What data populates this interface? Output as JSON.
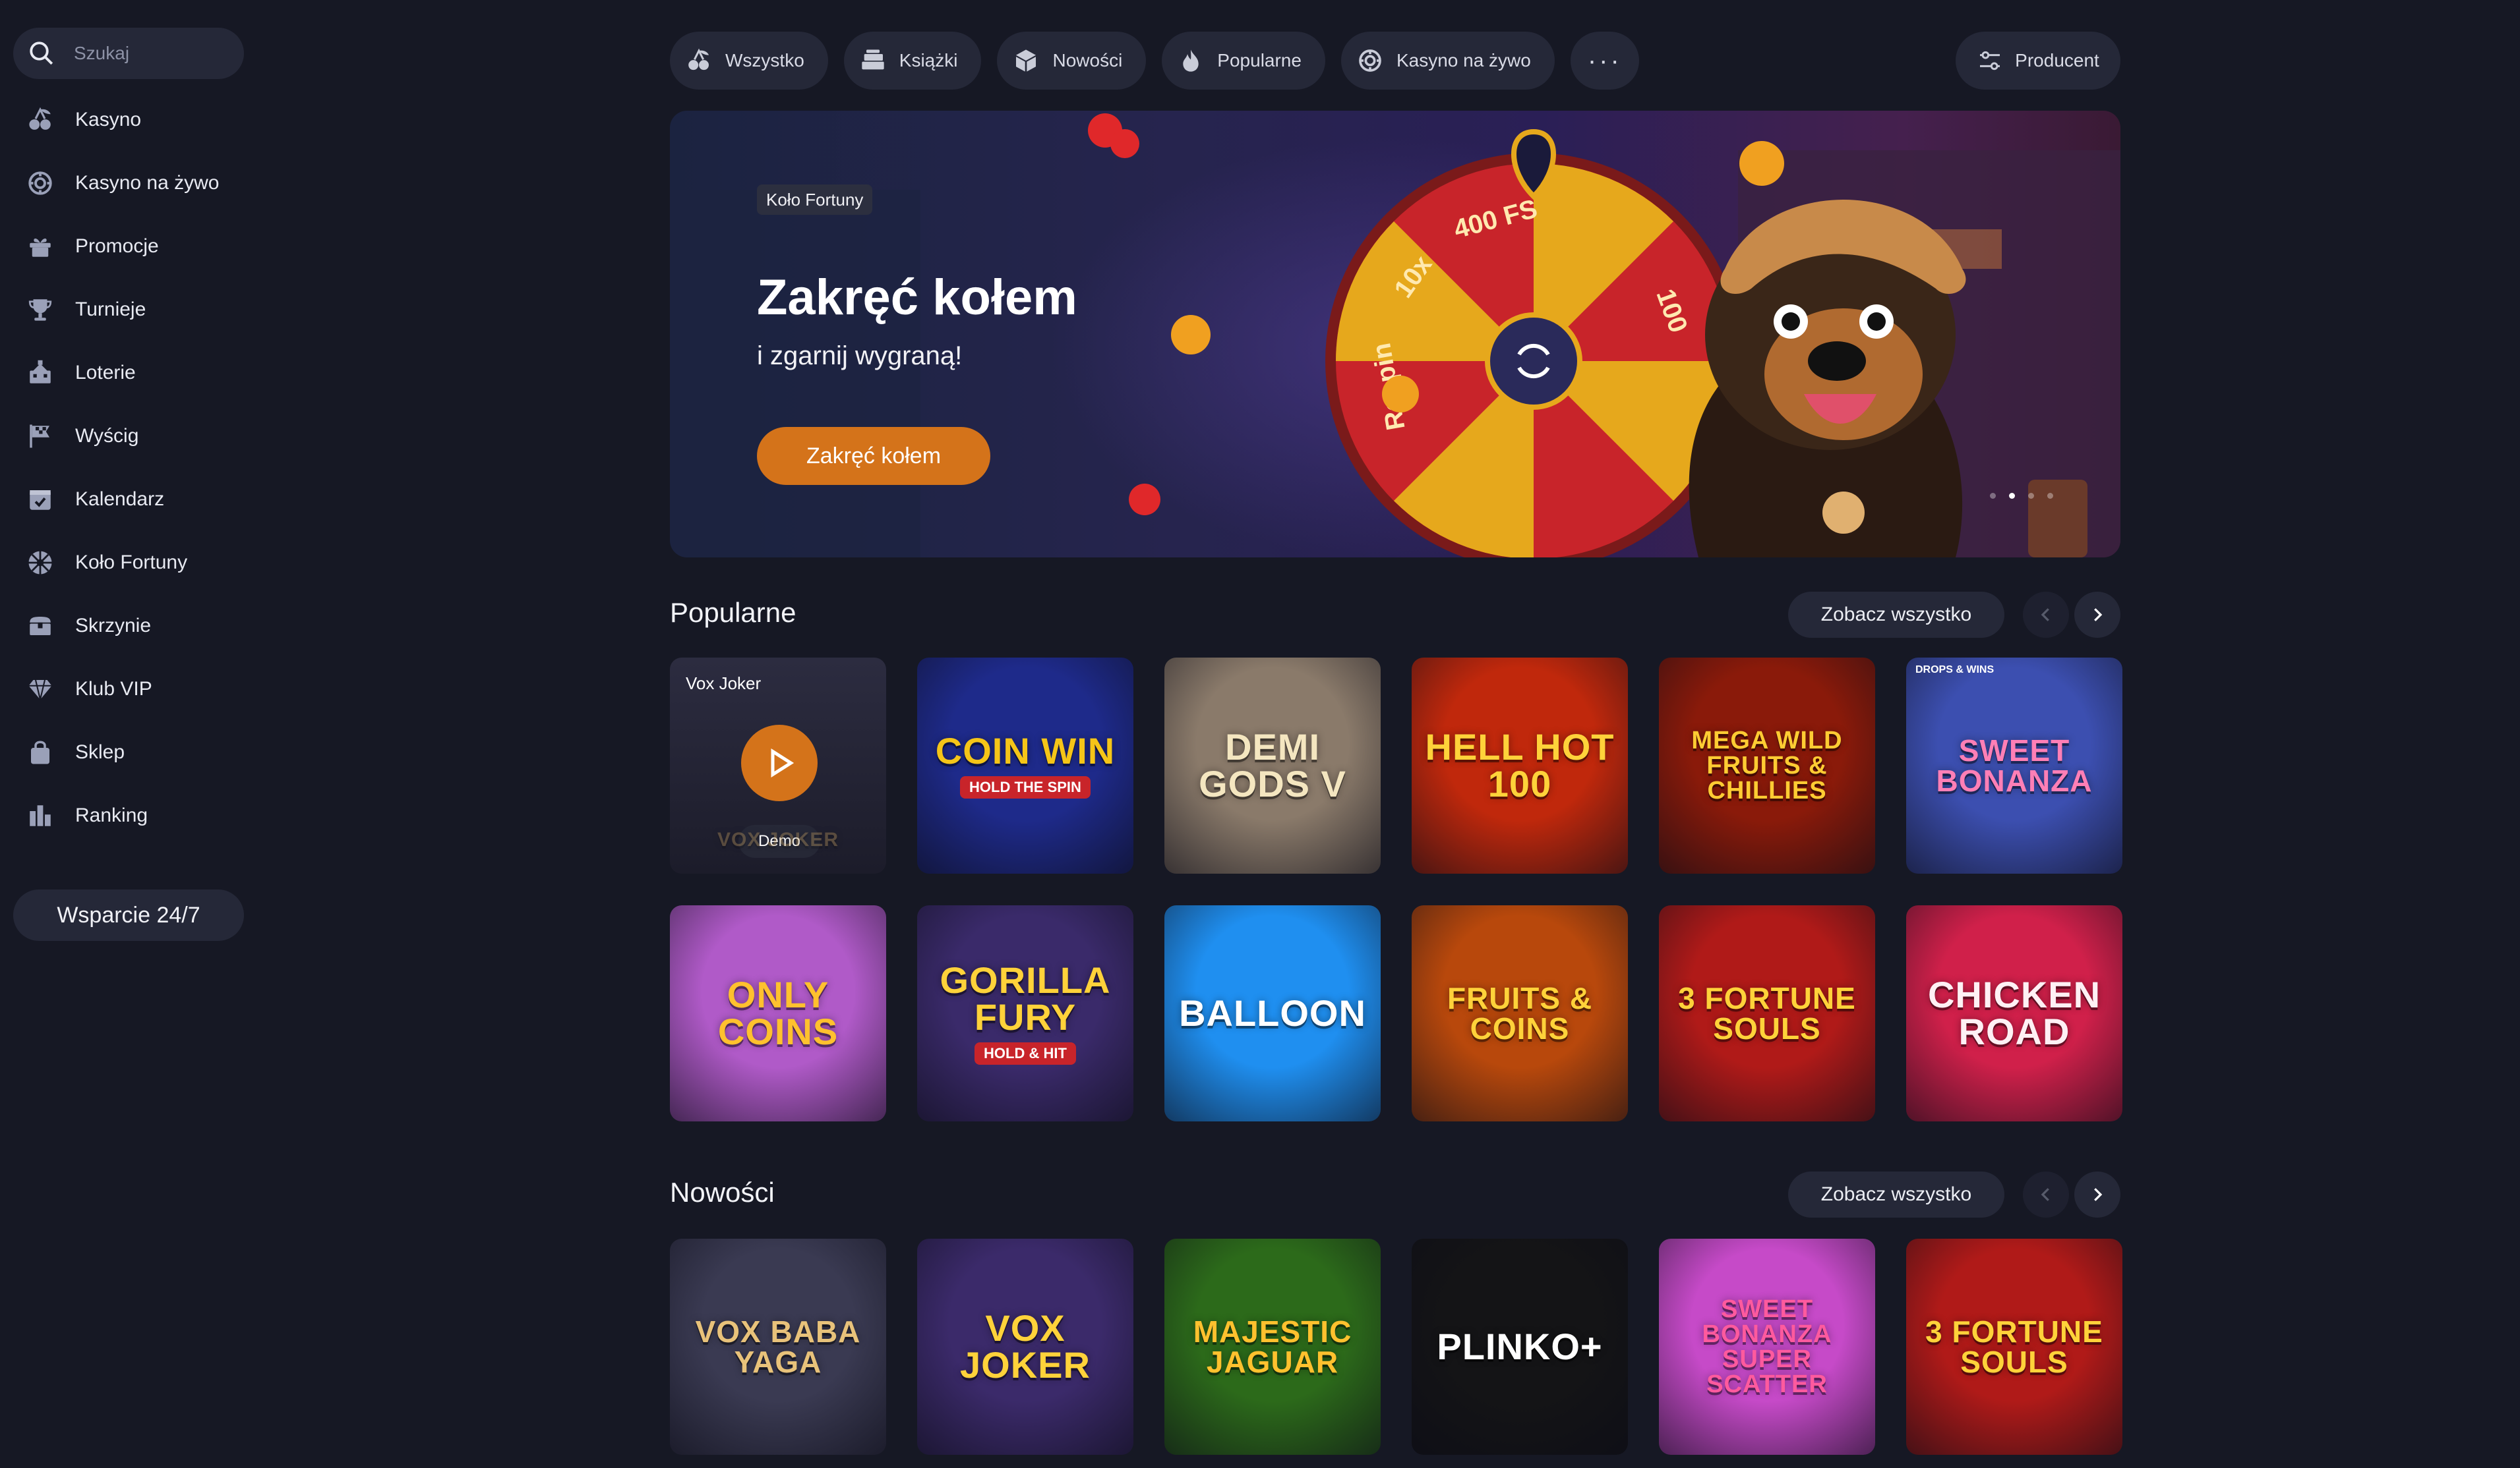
{
  "search": {
    "placeholder": "Szukaj"
  },
  "sidebar": {
    "items": [
      {
        "label": "Kasyno",
        "icon": "cherries-icon"
      },
      {
        "label": "Kasyno na żywo",
        "icon": "chip-icon"
      },
      {
        "label": "Promocje",
        "icon": "gift-icon"
      },
      {
        "label": "Turnieje",
        "icon": "trophy-icon"
      },
      {
        "label": "Loterie",
        "icon": "lottery-icon"
      },
      {
        "label": "Wyścig",
        "icon": "race-flag-icon"
      },
      {
        "label": "Kalendarz",
        "icon": "calendar-icon"
      },
      {
        "label": "Koło Fortuny",
        "icon": "wheel-icon"
      },
      {
        "label": "Skrzynie",
        "icon": "chest-icon"
      },
      {
        "label": "Klub VIP",
        "icon": "diamond-icon"
      },
      {
        "label": "Sklep",
        "icon": "shopping-bag-icon"
      },
      {
        "label": "Ranking",
        "icon": "ranking-icon"
      }
    ],
    "support_label": "Wsparcie 24/7"
  },
  "filters": {
    "chips": [
      {
        "label": "Wszystko",
        "icon": "cherries-icon"
      },
      {
        "label": "Książki",
        "icon": "books-icon"
      },
      {
        "label": "Nowości",
        "icon": "box-icon"
      },
      {
        "label": "Popularne",
        "icon": "flame-icon"
      },
      {
        "label": "Kasyno na żywo",
        "icon": "chip-icon"
      }
    ],
    "more_label": "···",
    "producer_label": "Producent"
  },
  "hero": {
    "tag": "Koło Fortuny",
    "title": "Zakręć kołem",
    "subtitle": "i zgarnij wygraną!",
    "button": "Zakręć kołem",
    "dots": 4,
    "active_dot": 1,
    "wheel_labels": [
      "400 FS",
      "100",
      "Respin",
      "10x"
    ]
  },
  "popular": {
    "title": "Popularne",
    "see_all": "Zobacz wszystko",
    "games": [
      {
        "name": "VOX JOKER",
        "label": "Vox Joker",
        "demo": "Demo",
        "bg": "#2a2a3e",
        "color": "#c8a060"
      },
      {
        "name": "COIN WIN",
        "sub": "HOLD THE SPIN",
        "bg": "#1e2a8a",
        "color": "#f5c518"
      },
      {
        "name": "DEMI GODS V",
        "bg": "#8a7a6a",
        "color": "#f4e6c0"
      },
      {
        "name": "HELL HOT 100",
        "bg": "#c0280c",
        "color": "#ffd23a"
      },
      {
        "name": "MEGA WILD FRUITS & Chillies",
        "bg": "#8a1a0a",
        "color": "#ffcc33"
      },
      {
        "name": "SWEET BONANZA",
        "badge": "DROPS & WINS",
        "bg": "#3c4fb0",
        "color": "#ff7fb6"
      },
      {
        "name": "Only COINS",
        "bg": "#b05ac8",
        "color": "#ffc12e"
      },
      {
        "name": "GORILLA FURY",
        "sub": "HOLD & HIT",
        "bg": "#3a2a6a",
        "color": "#ffd23a"
      },
      {
        "name": "BALLOON",
        "bg": "#1f8ff0",
        "color": "#ffffff"
      },
      {
        "name": "FRUITS & COINS",
        "bg": "#b8480c",
        "color": "#ffd23a"
      },
      {
        "name": "3 FORTUNE SOULS",
        "bg": "#b01a18",
        "color": "#ffd23a"
      },
      {
        "name": "CHICKEN ROAD",
        "bg": "#d0204a",
        "color": "#fff0f4"
      }
    ]
  },
  "new": {
    "title": "Nowości",
    "see_all": "Zobacz wszystko",
    "games": [
      {
        "name": "VOX BABA YAGA",
        "bg": "#3a3a52",
        "color": "#e8c27a"
      },
      {
        "name": "VOX JOKER",
        "bg": "#3b2a6a",
        "color": "#ffd23a"
      },
      {
        "name": "MAJESTIC JAGUAR",
        "bg": "#2c6a1a",
        "color": "#ffc12e"
      },
      {
        "name": "PLINKO+",
        "bg": "#141416",
        "color": "#ffffff"
      },
      {
        "name": "SWEET BONANZA SUPER SCATTER",
        "bg": "#c64ac8",
        "color": "#ff5a9e"
      },
      {
        "name": "3 FORTUNE SOULS",
        "bg": "#b01a18",
        "color": "#ffd23a"
      }
    ]
  },
  "colors": {
    "accent": "#d4731a",
    "panel": "#252838",
    "background": "#161824"
  }
}
